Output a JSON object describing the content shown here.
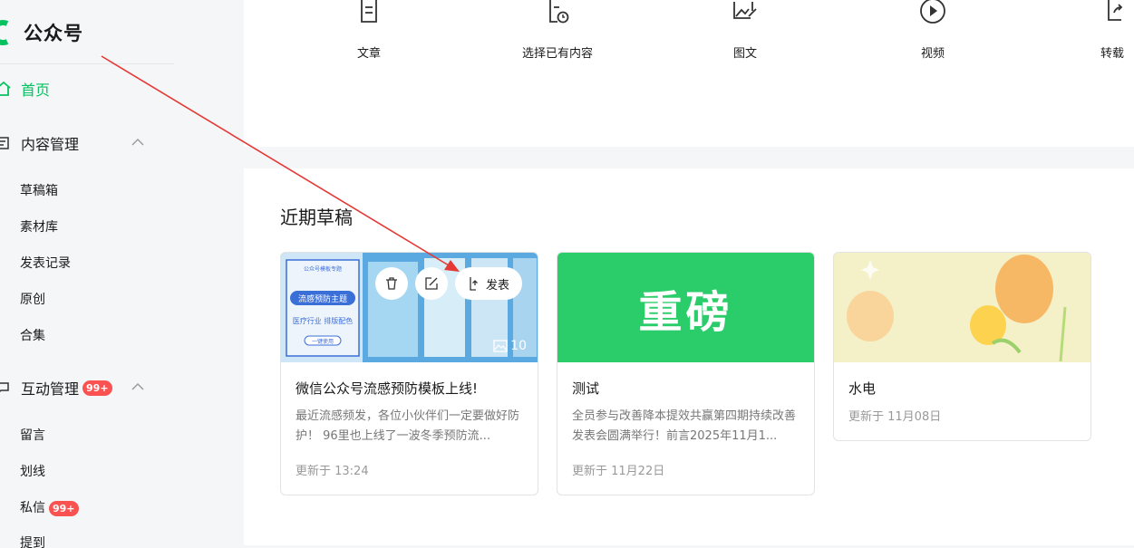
{
  "brand": {
    "name": "公众号"
  },
  "nav": {
    "home": "首页",
    "content_group": "内容管理",
    "content_items": [
      "草稿箱",
      "素材库",
      "发表记录",
      "原创",
      "合集"
    ],
    "interaction_group": "互动管理",
    "interaction_badge": "99+",
    "interaction_items": [
      "留言",
      "划线",
      "私信",
      "提到"
    ],
    "dm_badge": "99+"
  },
  "toolbar": {
    "items": [
      {
        "label": "文章",
        "icon": "document-icon"
      },
      {
        "label": "选择已有内容",
        "icon": "document-clock-icon"
      },
      {
        "label": "图文",
        "icon": "image-edit-icon"
      },
      {
        "label": "视频",
        "icon": "play-icon"
      },
      {
        "label": "转载",
        "icon": "share-icon"
      }
    ]
  },
  "drafts": {
    "title": "近期草稿",
    "publish_label": "发表",
    "cards": [
      {
        "title": "微信公众号流感预防模板上线!",
        "desc": "最近流感频发，各位小伙伴们一定要做好防护！ 96里也上线了一波冬季预防流...",
        "updated": "更新于 13:24",
        "image_count": "10",
        "cover_heading": "流感预防主题",
        "cover_sub": "医疗行业\n排版配色",
        "cover_tag": "公众号模板专题",
        "cover_btn": "一键使用"
      },
      {
        "title": "测试",
        "desc": "全员参与改善降本提效共赢第四期持续改善发表会圆满举行！前言2025年11月1...",
        "updated": "更新于 11月22日",
        "cover_text": "重磅"
      },
      {
        "title": "水电",
        "desc": "",
        "updated": "更新于 11月08日"
      }
    ]
  },
  "colors": {
    "accent": "#07c160",
    "badge": "#fa5151",
    "cover_green": "#2bcc6a",
    "annotation_arrow": "#e53935"
  }
}
